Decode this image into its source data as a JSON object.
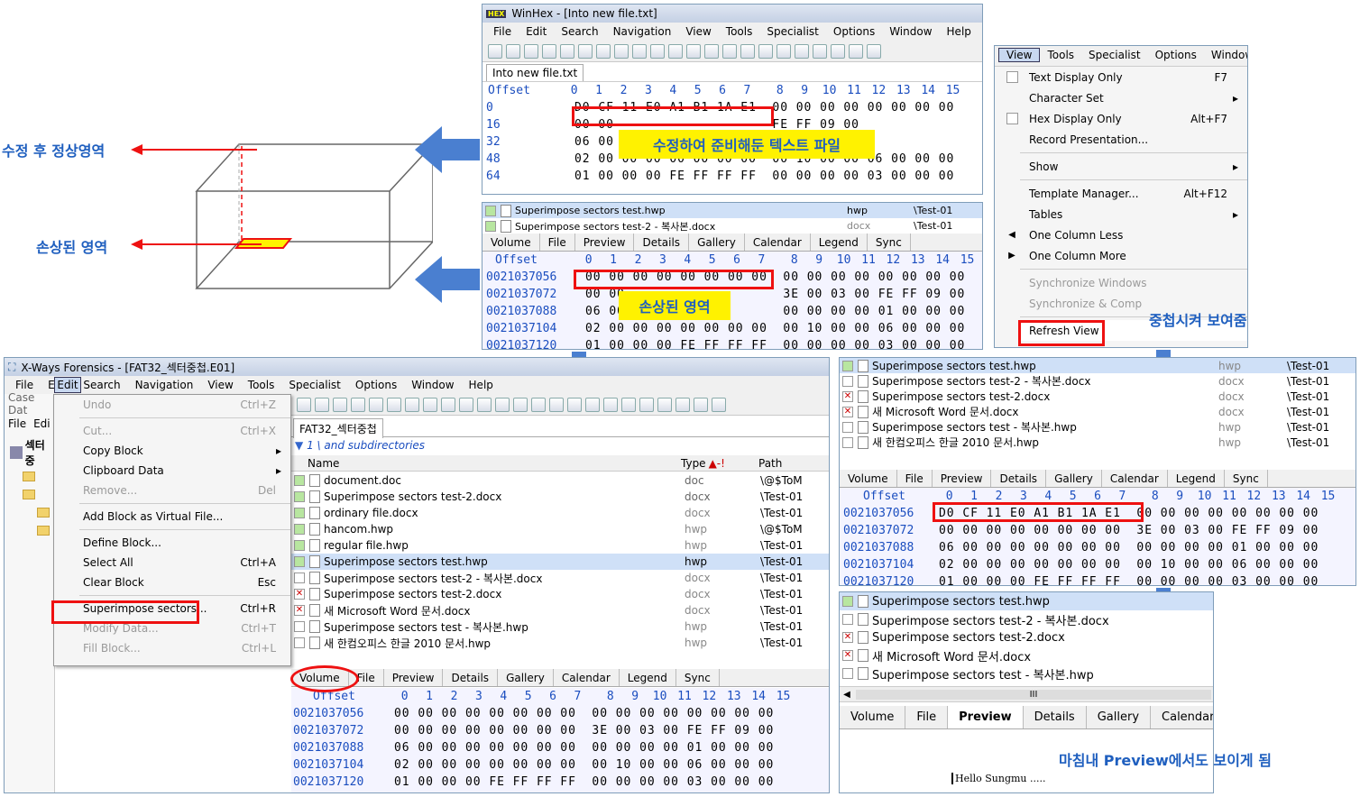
{
  "winhex": {
    "title": "WinHex - [Into new file.txt]",
    "menu": [
      "File",
      "Edit",
      "Search",
      "Navigation",
      "View",
      "Tools",
      "Specialist",
      "Options",
      "Window",
      "Help"
    ],
    "tab": "Into new file.txt",
    "offset_label": "Offset",
    "columns": [
      "0",
      "1",
      "2",
      "3",
      "4",
      "5",
      "6",
      "7",
      "8",
      "9",
      "10",
      "11",
      "12",
      "13",
      "14",
      "15"
    ],
    "rows": [
      {
        "off": "0",
        "hex": "D0 CF 11 E0 A1 B1 1A E1  00 00 00 00 00 00 00 00"
      },
      {
        "off": "16",
        "hex": "00 00                    FE FF 09 00"
      },
      {
        "off": "32",
        "hex": "06 00                    01 00 00 00"
      },
      {
        "off": "48",
        "hex": "02 00 00 00 00 00 00 00  00 10 00 00 06 00 00 00"
      },
      {
        "off": "64",
        "hex": "01 00 00 00 FE FF FF FF  00 00 00 00 03 00 00 00"
      }
    ],
    "overlay_label": "수정하여 준비해둔 텍스트 파일"
  },
  "damaged_panel": {
    "files": [
      {
        "name": "Superimpose sectors test.hwp",
        "ext": "hwp",
        "path": "\\Test-01"
      },
      {
        "name": "Superimpose sectors test-2 - 복사본.docx",
        "ext": "docx",
        "path": "\\Test-01"
      }
    ],
    "tabs": [
      "Volume",
      "File",
      "Preview",
      "Details",
      "Gallery",
      "Calendar",
      "Legend",
      "Sync"
    ],
    "offset_label": "Offset",
    "rows": [
      {
        "off": "0021037056",
        "hex": "00 00 00 00 00 00 00 00  00 00 00 00 00 00 00 00"
      },
      {
        "off": "0021037072",
        "hex": "00 00                    3E 00 03 00 FE FF 09 00"
      },
      {
        "off": "0021037088",
        "hex": "06 00                    00 00 00 00 01 00 00 00"
      },
      {
        "off": "0021037104",
        "hex": "02 00 00 00 00 00 00 00  00 10 00 00 06 00 00 00"
      },
      {
        "off": "0021037120",
        "hex": "01 00 00 00 FE FF FF FF  00 00 00 00 03 00 00 00"
      }
    ],
    "overlay_label": "손상된 영역"
  },
  "diagram": {
    "top_label": "수정 후 정상영역",
    "bottom_label": "손상된 영역"
  },
  "view_menu": {
    "menubar": [
      "View",
      "Tools",
      "Specialist",
      "Options",
      "Window"
    ],
    "items": [
      {
        "label": "Text Display Only",
        "shortcut": "F7",
        "icon": "checkbox-icon",
        "sub": false,
        "disabled": false
      },
      {
        "label": "Character Set",
        "shortcut": "",
        "icon": "",
        "sub": true,
        "disabled": false
      },
      {
        "label": "Hex Display Only",
        "shortcut": "Alt+F7",
        "icon": "checkbox-icon",
        "sub": false,
        "disabled": false
      },
      {
        "label": "Record Presentation...",
        "shortcut": "",
        "icon": "",
        "sub": false,
        "disabled": false
      },
      {
        "sep": true
      },
      {
        "label": "Show",
        "shortcut": "",
        "icon": "",
        "sub": true,
        "disabled": false
      },
      {
        "sep": true
      },
      {
        "label": "Template Manager...",
        "shortcut": "Alt+F12",
        "icon": "",
        "sub": false,
        "disabled": false
      },
      {
        "label": "Tables",
        "shortcut": "",
        "icon": "",
        "sub": true,
        "disabled": false
      },
      {
        "label": "One Column Less",
        "shortcut": "",
        "icon": "arrow-left-icon",
        "sub": false,
        "disabled": false
      },
      {
        "label": "One Column More",
        "shortcut": "",
        "icon": "arrow-right-icon",
        "sub": false,
        "disabled": false
      },
      {
        "sep": true
      },
      {
        "label": "Synchronize Windows",
        "shortcut": "",
        "icon": "",
        "sub": false,
        "disabled": true
      },
      {
        "label": "Synchronize & Comp",
        "shortcut": "",
        "icon": "",
        "sub": false,
        "disabled": true
      },
      {
        "sep": true
      },
      {
        "label": "Refresh View",
        "shortcut": "",
        "icon": "",
        "sub": false,
        "disabled": false,
        "highlight": true
      }
    ],
    "callout": "중첩시켜 보여줌"
  },
  "xways": {
    "title": "X-Ways Forensics - [FAT32_섹터중첩.E01]",
    "menu": [
      "File",
      "Edit",
      "Search",
      "Navigation",
      "View",
      "Tools",
      "Specialist",
      "Options",
      "Window",
      "Help"
    ],
    "left_tabs": [
      "Case Dat",
      "File",
      "Edi"
    ],
    "tree_root": "섹터중",
    "edit_menu": [
      {
        "label": "Undo",
        "shortcut": "Ctrl+Z",
        "disabled": true
      },
      {
        "sep": true
      },
      {
        "label": "Cut...",
        "shortcut": "Ctrl+X",
        "disabled": true
      },
      {
        "label": "Copy Block",
        "shortcut": "",
        "sub": true,
        "disabled": false
      },
      {
        "label": "Clipboard Data",
        "shortcut": "",
        "sub": true,
        "disabled": false
      },
      {
        "label": "Remove...",
        "shortcut": "Del",
        "disabled": true
      },
      {
        "sep": true
      },
      {
        "label": "Add Block as Virtual File...",
        "shortcut": "",
        "disabled": false
      },
      {
        "sep": true
      },
      {
        "label": "Define Block...",
        "shortcut": "",
        "disabled": false
      },
      {
        "label": "Select All",
        "shortcut": "Ctrl+A",
        "disabled": false
      },
      {
        "label": "Clear Block",
        "shortcut": "Esc",
        "disabled": false
      },
      {
        "sep": true
      },
      {
        "label": "Superimpose sectors...",
        "shortcut": "Ctrl+R",
        "disabled": false,
        "highlight": true
      },
      {
        "label": "Modify Data...",
        "shortcut": "Ctrl+T",
        "disabled": true
      },
      {
        "label": "Fill Block...",
        "shortcut": "Ctrl+L",
        "disabled": true
      }
    ],
    "doc_tab": "FAT32_섹터중첩",
    "filter_text": "1  \\ and subdirectories",
    "col_name": "Name",
    "col_type": "Type",
    "col_path": "Path",
    "type_sort_marker": "▲-!",
    "files": [
      {
        "name": "document.doc",
        "type": "doc",
        "path": "\\@$ToM",
        "chk": "g"
      },
      {
        "name": "Superimpose sectors test-2.docx",
        "type": "docx",
        "path": "\\Test-01",
        "chk": "g"
      },
      {
        "name": "ordinary file.docx",
        "type": "docx",
        "path": "\\Test-01",
        "chk": "g"
      },
      {
        "name": "hancom.hwp",
        "type": "hwp",
        "path": "\\@$ToM",
        "chk": "g"
      },
      {
        "name": "regular file.hwp",
        "type": "hwp",
        "path": "\\Test-01",
        "chk": "g"
      },
      {
        "name": "Superimpose sectors test.hwp",
        "type": "hwp",
        "path": "\\Test-01",
        "chk": "g",
        "selected": true
      },
      {
        "name": "Superimpose sectors test-2 - 복사본.docx",
        "type": "docx",
        "path": "\\Test-01",
        "chk": ""
      },
      {
        "name": "Superimpose sectors test-2.docx",
        "type": "docx",
        "path": "\\Test-01",
        "chk": "r"
      },
      {
        "name": "새 Microsoft Word 문서.docx",
        "type": "docx",
        "path": "\\Test-01",
        "chk": "r"
      },
      {
        "name": "Superimpose sectors test - 복사본.hwp",
        "type": "hwp",
        "path": "\\Test-01",
        "chk": ""
      },
      {
        "name": "새 한컴오피스 한글 2010 문서.hwp",
        "type": "hwp",
        "path": "\\Test-01",
        "chk": ""
      }
    ],
    "tabs": [
      "Volume",
      "File",
      "Preview",
      "Details",
      "Gallery",
      "Calendar",
      "Legend",
      "Sync"
    ],
    "offset_label": "Offset",
    "rows": [
      {
        "off": "0021037056",
        "hex": "00 00 00 00 00 00 00 00  00 00 00 00 00 00 00 00"
      },
      {
        "off": "0021037072",
        "hex": "00 00 00 00 00 00 00 00  3E 00 03 00 FE FF 09 00"
      },
      {
        "off": "0021037088",
        "hex": "06 00 00 00 00 00 00 00  00 00 00 00 01 00 00 00"
      },
      {
        "off": "0021037104",
        "hex": "02 00 00 00 00 00 00 00  00 10 00 00 06 00 00 00"
      },
      {
        "off": "0021037120",
        "hex": "01 00 00 00 FE FF FF FF  00 00 00 00 03 00 00 00"
      }
    ]
  },
  "result_panel": {
    "files": [
      {
        "name": "Superimpose sectors test.hwp",
        "ext": "hwp",
        "path": "\\Test-01",
        "chk": "g",
        "selected": true
      },
      {
        "name": "Superimpose sectors test-2 - 복사본.docx",
        "ext": "docx",
        "path": "\\Test-01",
        "chk": ""
      },
      {
        "name": "Superimpose sectors test-2.docx",
        "ext": "docx",
        "path": "\\Test-01",
        "chk": "r"
      },
      {
        "name": "새 Microsoft Word 문서.docx",
        "ext": "docx",
        "path": "\\Test-01",
        "chk": "r"
      },
      {
        "name": "Superimpose sectors test - 복사본.hwp",
        "ext": "hwp",
        "path": "\\Test-01",
        "chk": ""
      },
      {
        "name": "새 한컴오피스 한글 2010 문서.hwp",
        "ext": "hwp",
        "path": "\\Test-01",
        "chk": ""
      }
    ],
    "tabs": [
      "Volume",
      "File",
      "Preview",
      "Details",
      "Gallery",
      "Calendar",
      "Legend",
      "Sync"
    ],
    "offset_label": "Offset",
    "rows": [
      {
        "off": "0021037056",
        "hex": "D0 CF 11 E0 A1 B1 1A E1  00 00 00 00 00 00 00 00"
      },
      {
        "off": "0021037072",
        "hex": "00 00 00 00 00 00 00 00  3E 00 03 00 FE FF 09 00"
      },
      {
        "off": "0021037088",
        "hex": "06 00 00 00 00 00 00 00  00 00 00 00 01 00 00 00"
      },
      {
        "off": "0021037104",
        "hex": "02 00 00 00 00 00 00 00  00 10 00 00 06 00 00 00"
      },
      {
        "off": "0021037120",
        "hex": "01 00 00 00 FE FF FF FF  00 00 00 00 03 00 00 00"
      }
    ]
  },
  "preview_panel": {
    "files": [
      {
        "name": "Superimpose sectors test.hwp",
        "chk": "g",
        "selected": true
      },
      {
        "name": "Superimpose sectors test-2 - 복사본.docx",
        "chk": ""
      },
      {
        "name": "Superimpose sectors test-2.docx",
        "chk": "r"
      },
      {
        "name": "새 Microsoft Word 문서.docx",
        "chk": "r"
      },
      {
        "name": "Superimpose sectors test - 복사본.hwp",
        "chk": ""
      }
    ],
    "scroll_mark": "III",
    "tabs": [
      "Volume",
      "File",
      "Preview",
      "Details",
      "Gallery",
      "Calendar"
    ],
    "active_tab": "Preview",
    "preview_text": "Hello Sungmu .....",
    "callout": "마침내 Preview에서도 보이게 됨"
  },
  "colors": {
    "accent_blue": "#1f5fbf",
    "red_box": "#e11111",
    "highlight_yellow": "#fff200",
    "arrow_blue": "#4a7fd0"
  }
}
